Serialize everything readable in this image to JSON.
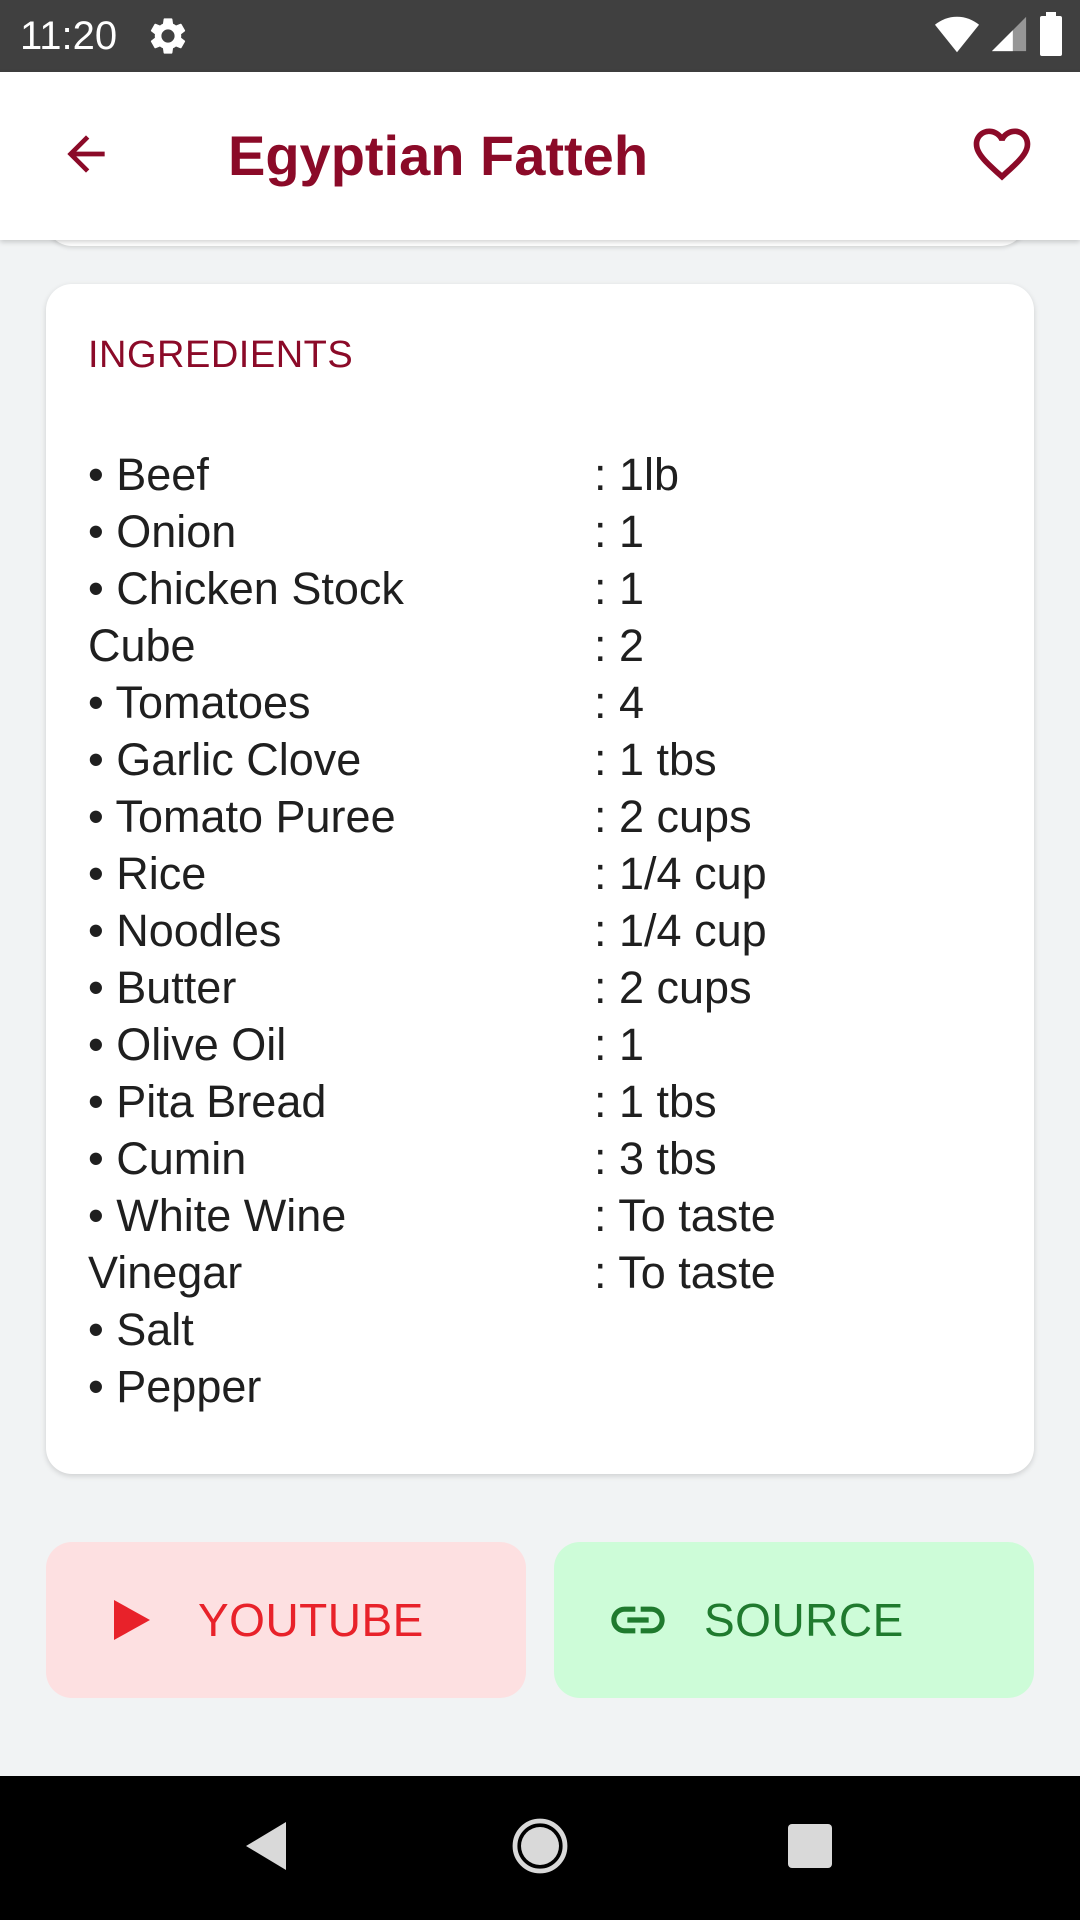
{
  "status_bar": {
    "time": "11:20",
    "icons": [
      "settings-icon",
      "wifi-icon",
      "signal-icon",
      "battery-icon"
    ]
  },
  "app_bar": {
    "title": "Egyptian Fatteh",
    "back_icon": "arrow-back-icon",
    "favorite_icon": "heart-outline-icon"
  },
  "ingredients": {
    "heading": "INGREDIENTS",
    "names": [
      "• Beef",
      "• Onion",
      "• Chicken Stock",
      "Cube",
      "• Tomatoes",
      "• Garlic Clove",
      "• Tomato Puree",
      "• Rice",
      "• Noodles",
      "• Butter",
      "• Olive Oil",
      "• Pita Bread",
      "• Cumin",
      "• White Wine",
      "Vinegar",
      "• Salt",
      "• Pepper"
    ],
    "measures": [
      ": 1lb",
      ": 1",
      ": 1",
      ": 2",
      ": 4",
      ": 1 tbs",
      ": 2 cups",
      ": 1/4 cup",
      ": 1/4 cup",
      ": 2 cups",
      ": 1",
      ": 1 tbs",
      ": 3 tbs",
      ": To taste",
      ": To taste"
    ]
  },
  "buttons": {
    "youtube": {
      "label": "YOUTUBE",
      "icon": "play-icon",
      "color": "#e8222a",
      "background": "#fde0e1"
    },
    "source": {
      "label": "SOURCE",
      "icon": "link-icon",
      "color": "#1f7a2e",
      "background": "#cdfcd8"
    }
  },
  "nav_bar": {
    "icons": [
      "nav-back-icon",
      "nav-home-icon",
      "nav-recents-icon"
    ]
  },
  "colors": {
    "accent": "#8b0a28",
    "background": "#f1f3f4"
  }
}
